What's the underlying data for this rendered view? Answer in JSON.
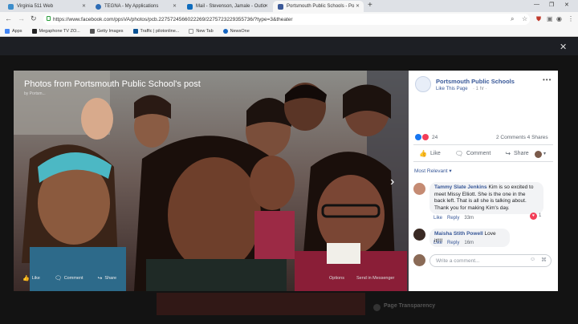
{
  "browser": {
    "tabs": [
      {
        "title": "Virginia 511 Web",
        "color": "#3c8dcb"
      },
      {
        "title": "TEGNA - My Applications",
        "color": "#2d6cb5"
      },
      {
        "title": "Mail - Stevenson, Jamale - Outlo",
        "color": "#0f6cbd"
      },
      {
        "title": "Portsmouth Public Schools - Po",
        "color": "#3b5998"
      }
    ],
    "url": "https://www.facebook.com/ppsVA/photos/pcb.2275724566022269/2275723229355736/?type=3&theater",
    "bookmarks": [
      "Apps",
      "Megaphone TV ZO...",
      "Getty Images",
      "Traffic | pilotonline...",
      "New Tab",
      "NewsOne"
    ]
  },
  "photo": {
    "title": "Photos from Portsmouth Public School's post",
    "sub": "by Portsm...",
    "actions": {
      "like": "Like",
      "comment": "Comment",
      "share": "Share"
    },
    "options": "Options",
    "send": "Send in Messenger"
  },
  "post": {
    "page_name": "Portsmouth Public Schools",
    "like_page": "Like This Page",
    "time": "· 1 hr ·",
    "reaction_count": "24",
    "comments_shares": "2 Comments  4 Shares",
    "actions": {
      "like": "Like",
      "comment": "Comment",
      "share": "Share"
    },
    "sort": "Most Relevant ▾",
    "colors": {
      "link": "#385898",
      "like_blue": "#1877f2",
      "love_red": "#f33e58"
    }
  },
  "comments": [
    {
      "author": "Tammy Slate Jenkins",
      "lines": [
        "Kim is so excited to",
        "meet Missy Elliott. She is the one in the",
        "back left. That is all she is talking about.",
        "Thank you for making Kim's day."
      ],
      "like": "Like",
      "reply": "Reply",
      "time": "33m",
      "reaction_count": "1"
    },
    {
      "author": "Maisha Stith Powell",
      "lines": [
        "Love it!!!!"
      ],
      "like": "Like",
      "reply": "Reply",
      "time": "16m"
    }
  ],
  "composer": {
    "placeholder": "Write a comment..."
  },
  "background": {
    "page_transparency": "Page Transparency"
  }
}
